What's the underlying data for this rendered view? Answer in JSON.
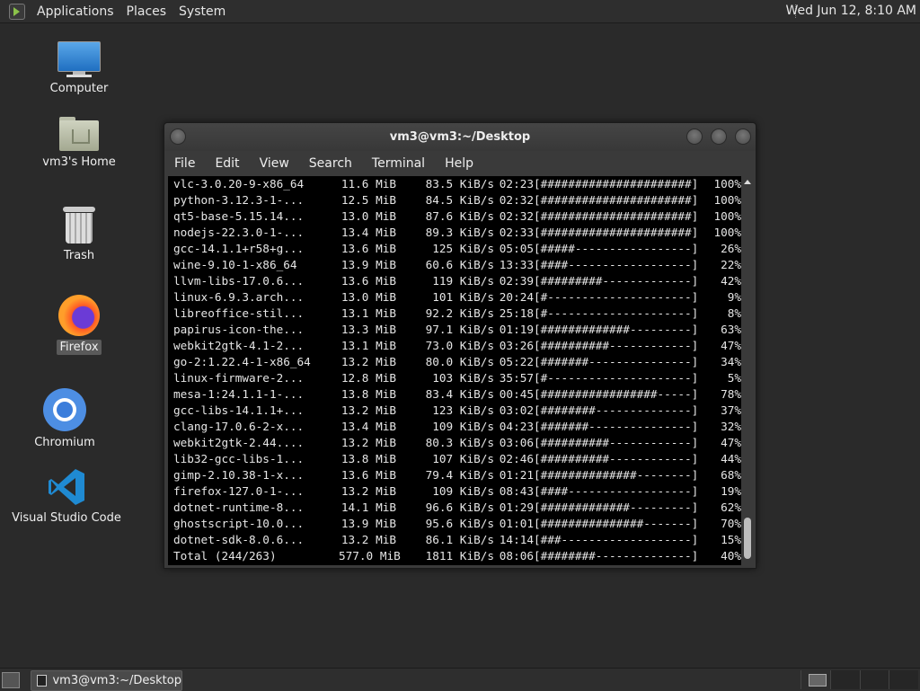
{
  "top_panel": {
    "menus": [
      "Applications",
      "Places",
      "System"
    ],
    "clock": "Wed Jun 12,  8:10 AM"
  },
  "desktop": {
    "icons": [
      {
        "label": "Computer",
        "icon": "computer-icon"
      },
      {
        "label": "vm3's Home",
        "icon": "home-folder-icon"
      },
      {
        "label": "Trash",
        "icon": "trash-icon"
      },
      {
        "label": "Firefox",
        "icon": "firefox-icon",
        "selected": true
      },
      {
        "label": "Chromium",
        "icon": "chromium-icon"
      },
      {
        "label": "Visual Studio Code",
        "icon": "vscode-icon"
      }
    ]
  },
  "terminal": {
    "title": "vm3@vm3:~/Desktop",
    "menu": [
      "File",
      "Edit",
      "View",
      "Search",
      "Terminal",
      "Help"
    ],
    "rows": [
      {
        "name": "vlc-3.0.20-9-x86_64",
        "size": "11.6 MiB",
        "rate": "83.5 KiB/s",
        "time": "02:23",
        "bar": "[######################]",
        "pct": "100%"
      },
      {
        "name": "python-3.12.3-1-...",
        "size": "12.5 MiB",
        "rate": "84.5 KiB/s",
        "time": "02:32",
        "bar": "[######################]",
        "pct": "100%"
      },
      {
        "name": "qt5-base-5.15.14...",
        "size": "13.0 MiB",
        "rate": "87.6 KiB/s",
        "time": "02:32",
        "bar": "[######################]",
        "pct": "100%"
      },
      {
        "name": "nodejs-22.3.0-1-...",
        "size": "13.4 MiB",
        "rate": "89.3 KiB/s",
        "time": "02:33",
        "bar": "[######################]",
        "pct": "100%"
      },
      {
        "name": "gcc-14.1.1+r58+g...",
        "size": "13.6 MiB",
        "rate": "125 KiB/s",
        "time": "05:05",
        "bar": "[#####-----------------]",
        "pct": "26%"
      },
      {
        "name": "wine-9.10-1-x86_64",
        "size": "13.9 MiB",
        "rate": "60.6 KiB/s",
        "time": "13:33",
        "bar": "[####------------------]",
        "pct": "22%"
      },
      {
        "name": "llvm-libs-17.0.6...",
        "size": "13.6 MiB",
        "rate": "119 KiB/s",
        "time": "02:39",
        "bar": "[#########-------------]",
        "pct": "42%"
      },
      {
        "name": "linux-6.9.3.arch...",
        "size": "13.0 MiB",
        "rate": "101 KiB/s",
        "time": "20:24",
        "bar": "[#---------------------]",
        "pct": "9%"
      },
      {
        "name": "libreoffice-stil...",
        "size": "13.1 MiB",
        "rate": "92.2 KiB/s",
        "time": "25:18",
        "bar": "[#---------------------]",
        "pct": "8%"
      },
      {
        "name": "papirus-icon-the...",
        "size": "13.3 MiB",
        "rate": "97.1 KiB/s",
        "time": "01:19",
        "bar": "[#############---------]",
        "pct": "63%"
      },
      {
        "name": "webkit2gtk-4.1-2...",
        "size": "13.1 MiB",
        "rate": "73.0 KiB/s",
        "time": "03:26",
        "bar": "[##########------------]",
        "pct": "47%"
      },
      {
        "name": "go-2:1.22.4-1-x86_64",
        "size": "13.2 MiB",
        "rate": "80.0 KiB/s",
        "time": "05:22",
        "bar": "[#######---------------]",
        "pct": "34%"
      },
      {
        "name": "linux-firmware-2...",
        "size": "12.8 MiB",
        "rate": "103 KiB/s",
        "time": "35:57",
        "bar": "[#---------------------]",
        "pct": "5%"
      },
      {
        "name": "mesa-1:24.1.1-1-...",
        "size": "13.8 MiB",
        "rate": "83.4 KiB/s",
        "time": "00:45",
        "bar": "[#################-----]",
        "pct": "78%"
      },
      {
        "name": "gcc-libs-14.1.1+...",
        "size": "13.2 MiB",
        "rate": "123 KiB/s",
        "time": "03:02",
        "bar": "[########--------------]",
        "pct": "37%"
      },
      {
        "name": "clang-17.0.6-2-x...",
        "size": "13.4 MiB",
        "rate": "109 KiB/s",
        "time": "04:23",
        "bar": "[#######---------------]",
        "pct": "32%"
      },
      {
        "name": "webkit2gtk-2.44....",
        "size": "13.2 MiB",
        "rate": "80.3 KiB/s",
        "time": "03:06",
        "bar": "[##########------------]",
        "pct": "47%"
      },
      {
        "name": "lib32-gcc-libs-1...",
        "size": "13.8 MiB",
        "rate": "107 KiB/s",
        "time": "02:46",
        "bar": "[##########------------]",
        "pct": "44%"
      },
      {
        "name": "gimp-2.10.38-1-x...",
        "size": "13.6 MiB",
        "rate": "79.4 KiB/s",
        "time": "01:21",
        "bar": "[##############--------]",
        "pct": "68%"
      },
      {
        "name": "firefox-127.0-1-...",
        "size": "13.2 MiB",
        "rate": "109 KiB/s",
        "time": "08:43",
        "bar": "[####------------------]",
        "pct": "19%"
      },
      {
        "name": "dotnet-runtime-8...",
        "size": "14.1 MiB",
        "rate": "96.6 KiB/s",
        "time": "01:29",
        "bar": "[#############---------]",
        "pct": "62%"
      },
      {
        "name": "ghostscript-10.0...",
        "size": "13.9 MiB",
        "rate": "95.6 KiB/s",
        "time": "01:01",
        "bar": "[###############-------]",
        "pct": "70%"
      },
      {
        "name": "dotnet-sdk-8.0.6...",
        "size": "13.2 MiB",
        "rate": "86.1 KiB/s",
        "time": "14:14",
        "bar": "[###-------------------]",
        "pct": "15%"
      },
      {
        "name": "Total (244/263)",
        "size": "577.0 MiB",
        "rate": "1811 KiB/s",
        "time": "08:06",
        "bar": "[########--------------]",
        "pct": "40%"
      }
    ]
  },
  "taskbar": {
    "items": [
      {
        "label": "vm3@vm3:~/Desktop"
      }
    ]
  }
}
